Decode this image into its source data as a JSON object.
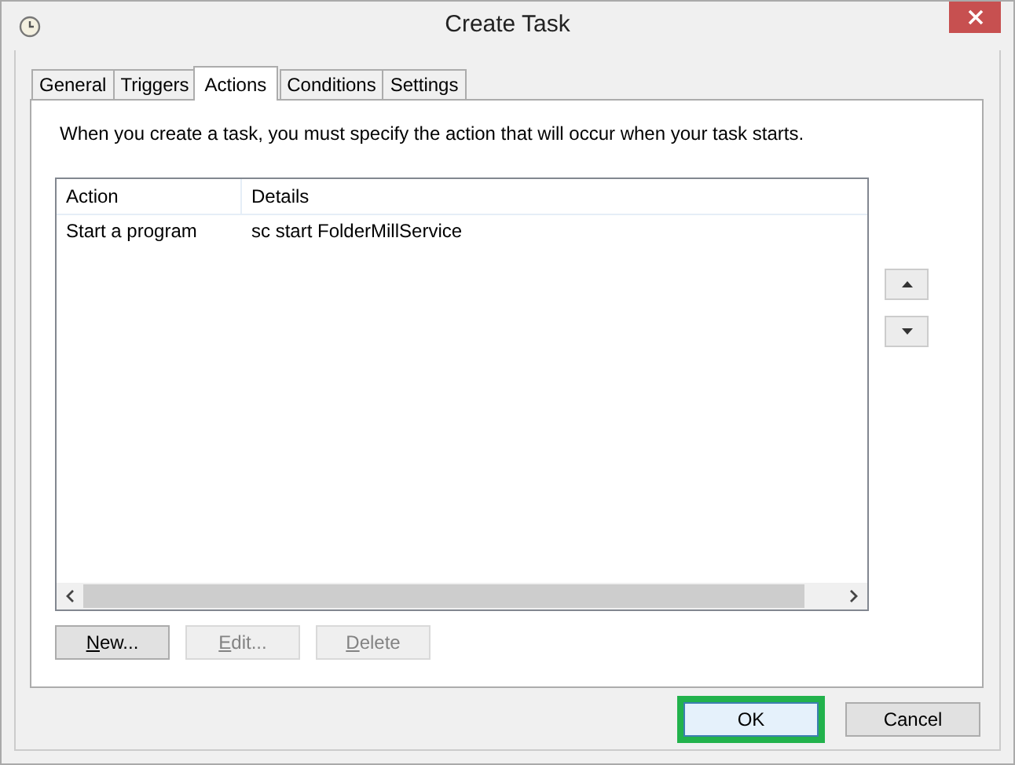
{
  "window": {
    "title": "Create Task"
  },
  "tabs": [
    {
      "label": "General",
      "selected": false
    },
    {
      "label": "Triggers",
      "selected": false
    },
    {
      "label": "Actions",
      "selected": true
    },
    {
      "label": "Conditions",
      "selected": false
    },
    {
      "label": "Settings",
      "selected": false
    }
  ],
  "description": "When you create a task, you must specify the action that will occur when your task starts.",
  "table": {
    "columns": [
      "Action",
      "Details"
    ],
    "rows": [
      [
        "Start a program",
        "sc start FolderMillService"
      ]
    ]
  },
  "list_buttons": [
    {
      "label": "New...",
      "disabled": false
    },
    {
      "label": "Edit...",
      "disabled": true
    },
    {
      "label": "Delete",
      "disabled": true
    }
  ],
  "dialog_buttons": [
    {
      "label": "OK",
      "highlighted": true
    },
    {
      "label": "Cancel",
      "highlighted": false
    }
  ]
}
